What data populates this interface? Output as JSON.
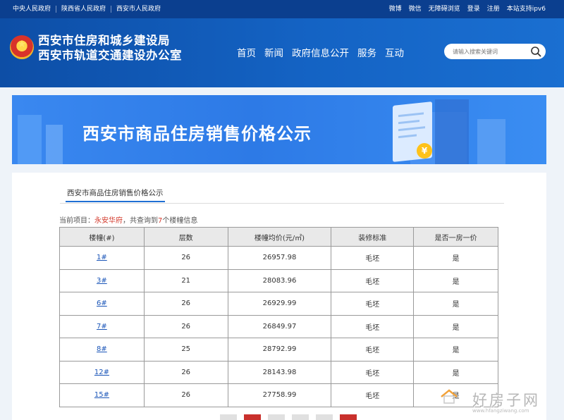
{
  "topbar": {
    "left_links": [
      "中央人民政府",
      "陕西省人民政府",
      "西安市人民政府"
    ],
    "right_links": [
      "微博",
      "微信",
      "无障碍浏览",
      "登录",
      "注册",
      "本站支持ipv6"
    ]
  },
  "header": {
    "title_line1": "西安市住房和城乡建设局",
    "title_line2": "西安市轨道交通建设办公室",
    "nav": [
      "首页",
      "新闻",
      "政府信息公开",
      "服务",
      "互动"
    ],
    "search_placeholder": "请输入搜索关键词"
  },
  "banner": {
    "headline": "西安市商品住房销售价格公示"
  },
  "panel": {
    "tab_label": "西安市商品住房销售价格公示",
    "info_prefix": "当前项目：",
    "project_name": "永安华府",
    "info_middle": "，共查询到",
    "building_count": "7",
    "info_suffix": "个楼幢信息"
  },
  "table": {
    "headers": [
      "楼幢(#)",
      "层数",
      "楼幢均价(元/㎡)",
      "装修标准",
      "是否一房一价"
    ],
    "rows": [
      [
        "1#",
        "26",
        "26957.98",
        "毛坯",
        "是"
      ],
      [
        "3#",
        "21",
        "28083.96",
        "毛坯",
        "是"
      ],
      [
        "6#",
        "26",
        "26929.99",
        "毛坯",
        "是"
      ],
      [
        "7#",
        "26",
        "26849.97",
        "毛坯",
        "是"
      ],
      [
        "8#",
        "25",
        "28792.99",
        "毛坯",
        "是"
      ],
      [
        "12#",
        "26",
        "28143.98",
        "毛坯",
        "是"
      ],
      [
        "15#",
        "26",
        "27758.99",
        "毛坯",
        "是"
      ]
    ]
  },
  "watermark": {
    "text": "好房子网",
    "url": "www.hfangziwang.com"
  },
  "colors": {
    "header_blue": "#1463c4",
    "topbar_blue": "#0b3f8f",
    "accent_red": "#d33a2c",
    "link_blue": "#1a55b8"
  }
}
